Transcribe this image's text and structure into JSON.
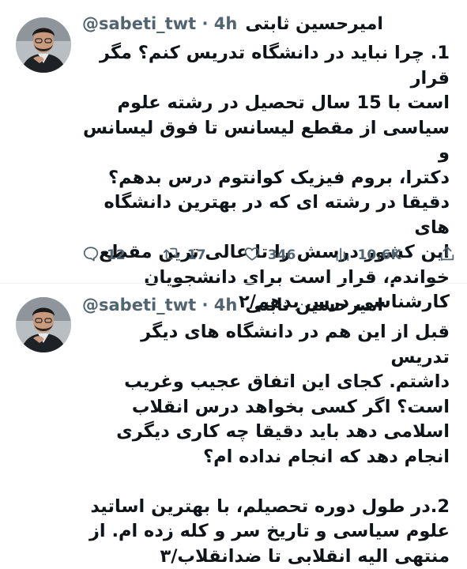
{
  "tweets": [
    {
      "author": {
        "name": "امیرحسین ثابتی",
        "handle": "@sabeti_twt",
        "time": "· 4h"
      },
      "lines": [
        "1. چرا نباید در دانشگاه تدریس کنم؟ مگر قرار",
        "است با 15 سال تحصیل در رشته علوم",
        "سیاسی از مقطع لیسانس تا فوق لیسانس و",
        "دکترا، بروم فیزیک کوانتوم درس بدهم؟",
        "دقیقا در رشته ای که در بهترین دانشگاه های",
        "این کشور درسش را تا عالی ترین مقطع",
        "خواندم، قرار است برای دانشجویان",
        "کارشناسی درس بدهم/۲"
      ],
      "actions": {
        "replies": "12",
        "retweets": "17",
        "likes": "346",
        "views": "10.6K"
      }
    },
    {
      "author": {
        "name": "امیرحسین ثابتی",
        "handle": "@sabeti_twt",
        "time": "· 4h"
      },
      "lines": [
        "قبل از این هم در دانشگاه های دیگر تدریس",
        "داشتم. کجای این اتفاق عجیب وغریب",
        "است؟ اگر کسی بخواهد درس انقلاب",
        "اسلامی دهد باید دقیقا چه کاری دیگری",
        "انجام دهد که انجام نداده ام؟",
        "",
        "2.در طول دوره تحصیلم، با بهترین اساتید",
        "علوم سیاسی و تاریخ سر و کله زده ام. از",
        "منتهی الیه انقلابی تا ضدانقلاب/۳"
      ]
    }
  ],
  "icons": {
    "reply": "reply-icon",
    "retweet": "retweet-icon",
    "like": "heart-icon",
    "views": "views-icon",
    "share": "share-icon"
  },
  "colors": {
    "text": "#0f1419",
    "secondary": "#536471",
    "divider": "#eff3f4"
  }
}
